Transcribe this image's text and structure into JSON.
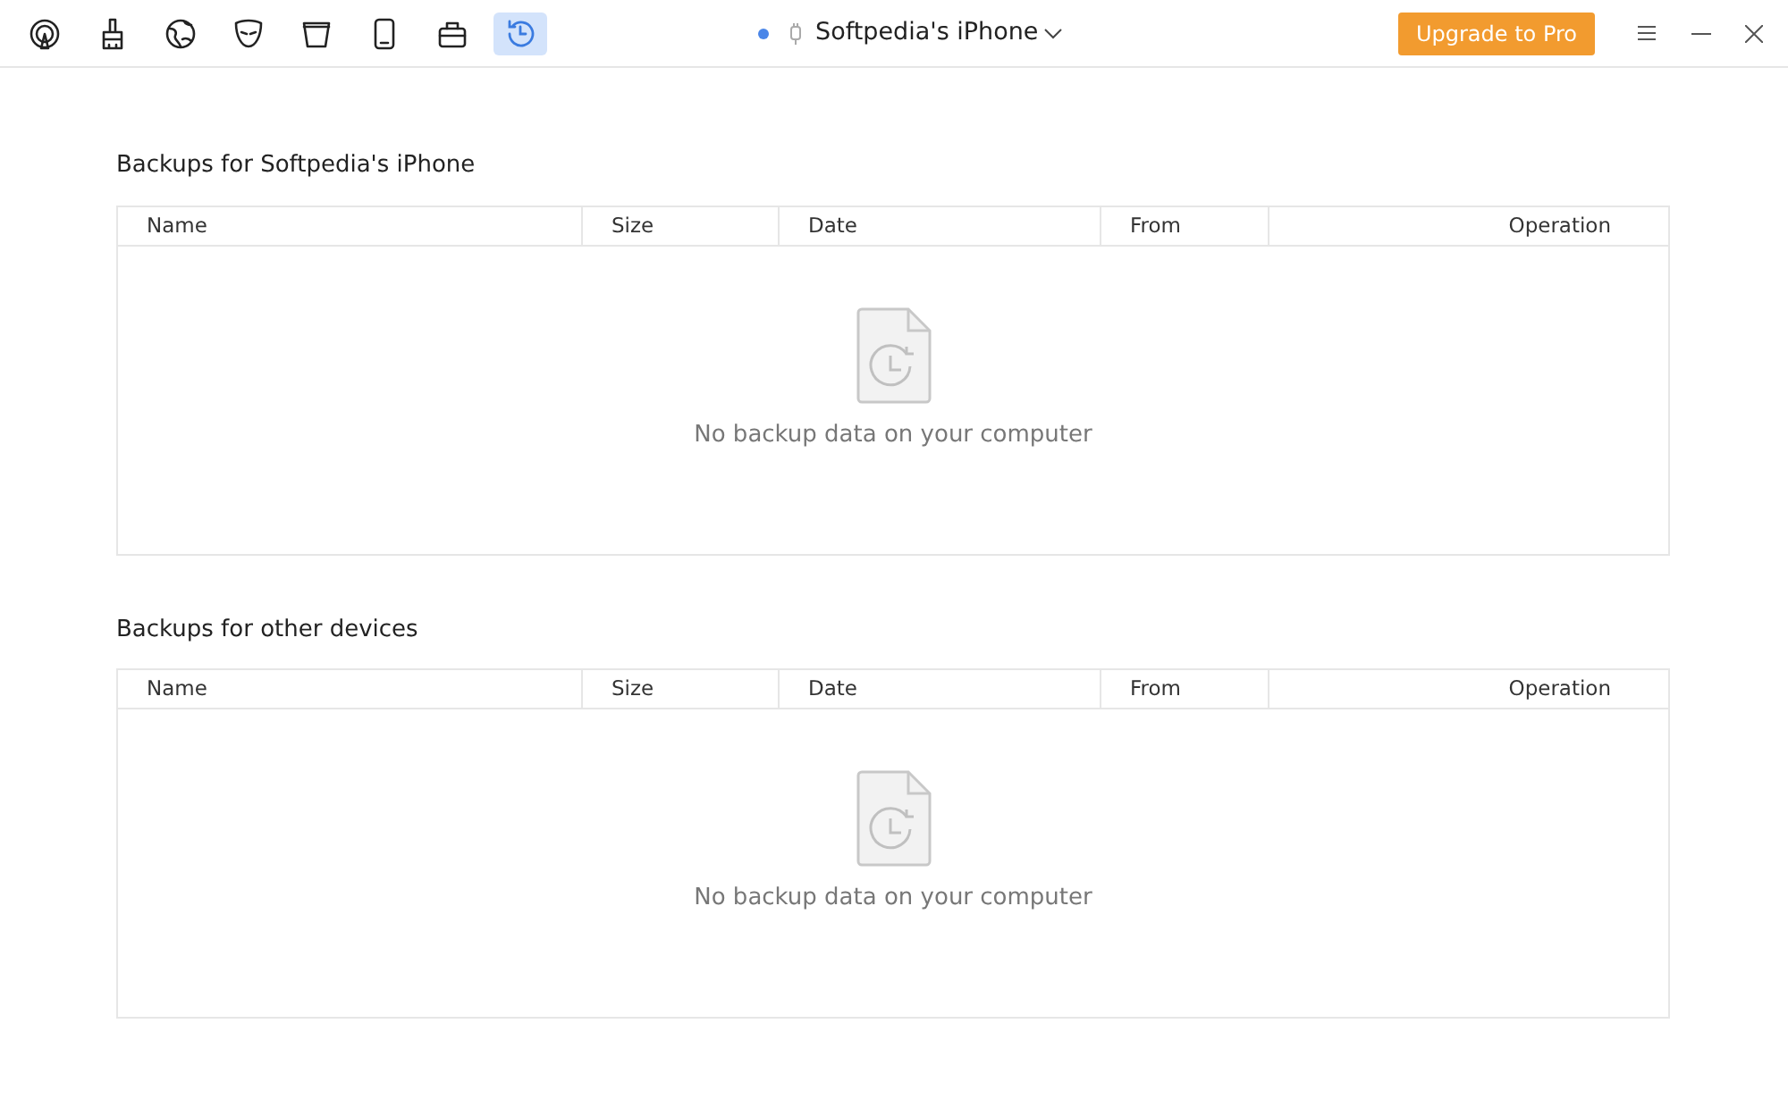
{
  "toolbar": [
    {
      "selected": false
    },
    {
      "selected": false
    },
    {
      "selected": false
    },
    {
      "selected": false
    },
    {
      "selected": false
    },
    {
      "selected": false
    },
    {
      "selected": false
    },
    {
      "selected": true
    }
  ],
  "device": {
    "name": "Softpedia's iPhone",
    "connected": true
  },
  "upgrade_button": "Upgrade to Pro",
  "sections": [
    {
      "title": "Backups for Softpedia's iPhone",
      "columns": [
        "Name",
        "Size",
        "Date",
        "From",
        "Operation"
      ],
      "empty_message": "No backup data on your computer"
    },
    {
      "title": "Backups for other devices",
      "columns": [
        "Name",
        "Size",
        "Date",
        "From",
        "Operation"
      ],
      "empty_message": "No backup data on your computer"
    }
  ]
}
